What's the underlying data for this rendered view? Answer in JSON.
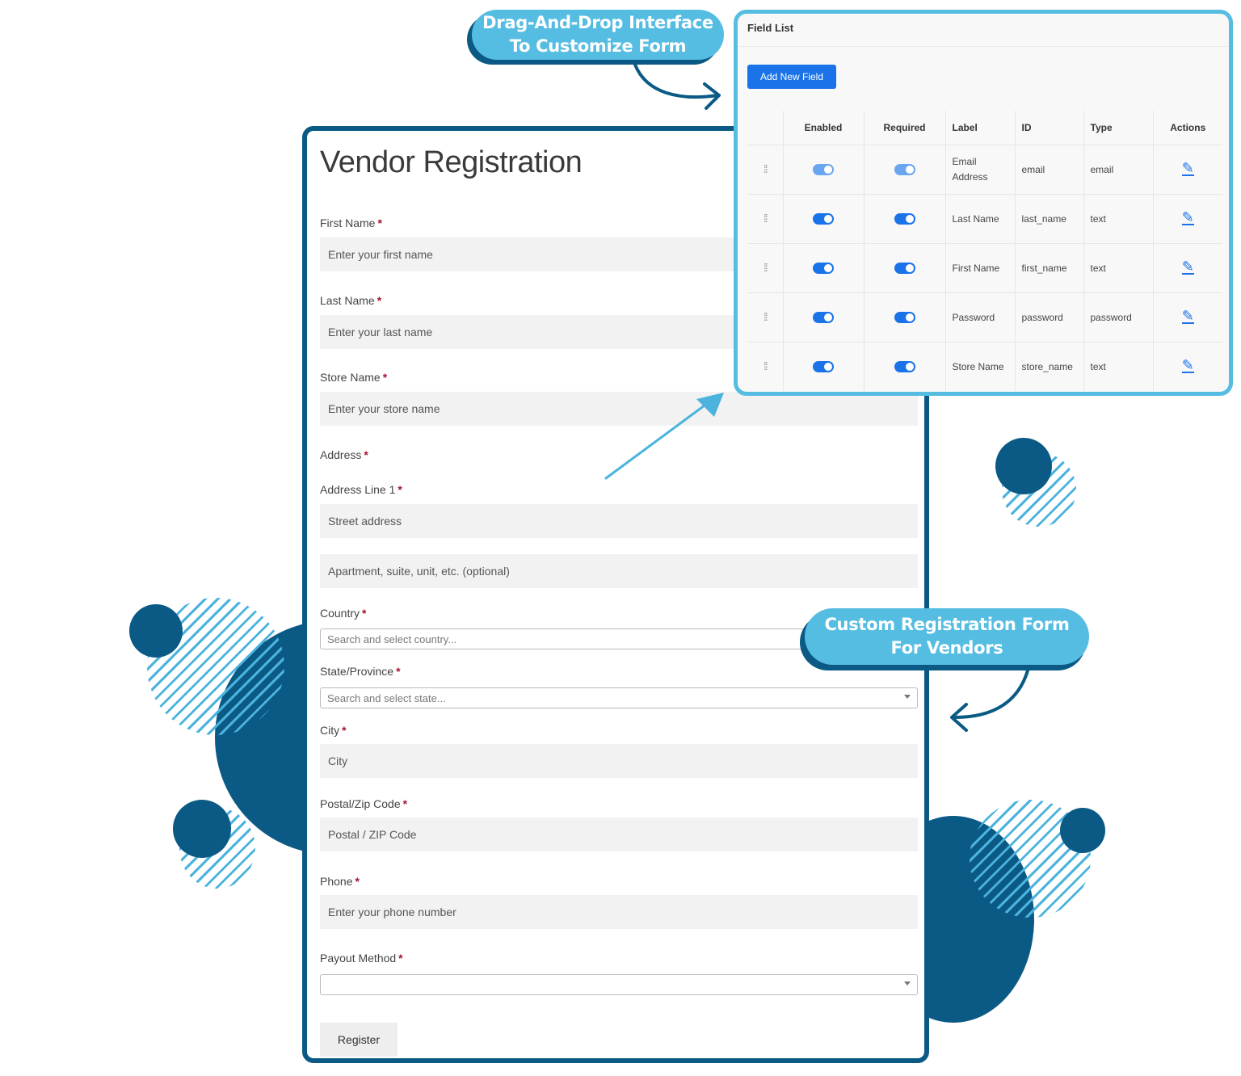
{
  "callouts": {
    "top_line1": "Drag-And-Drop Interface",
    "top_line2": "To Customize Form",
    "right_line1": "Custom Registration Form",
    "right_line2": "For Vendors"
  },
  "form": {
    "title": "Vendor Registration",
    "required_mark": "*",
    "first_name_label": "First Name",
    "first_name_placeholder": "Enter your first name",
    "last_name_label": "Last Name",
    "last_name_placeholder": "Enter your last name",
    "store_name_label": "Store Name",
    "store_name_placeholder": "Enter your store name",
    "address_label": "Address",
    "address_line1_label": "Address Line 1",
    "street_placeholder": "Street address",
    "apartment_placeholder": "Apartment, suite, unit, etc. (optional)",
    "country_label": "Country",
    "country_placeholder": "Search and select country...",
    "state_label": "State/Province",
    "state_placeholder": "Search and select state...",
    "city_label": "City",
    "city_placeholder": "City",
    "postal_label": "Postal/Zip Code",
    "postal_placeholder": "Postal / ZIP Code",
    "phone_label": "Phone",
    "phone_placeholder": "Enter your phone number",
    "payout_label": "Payout Method",
    "payout_value": "",
    "register_label": "Register"
  },
  "field_list": {
    "title": "Field List",
    "add_button": "Add New Field",
    "columns": [
      "Enabled",
      "Required",
      "Label",
      "ID",
      "Type",
      "Actions"
    ],
    "rows": [
      {
        "label": "Email Address",
        "id": "email",
        "type": "email"
      },
      {
        "label": "Last Name",
        "id": "last_name",
        "type": "text"
      },
      {
        "label": "First Name",
        "id": "first_name",
        "type": "text"
      },
      {
        "label": "Password",
        "id": "password",
        "type": "password"
      },
      {
        "label": "Store Name",
        "id": "store_name",
        "type": "text"
      }
    ],
    "icons": {
      "drag": "drag-handle-icon",
      "edit": "pencil-icon"
    },
    "accent_color": "#1a73e8"
  },
  "colors": {
    "dark_blue": "#0a5a85",
    "light_blue": "#56bde2"
  }
}
